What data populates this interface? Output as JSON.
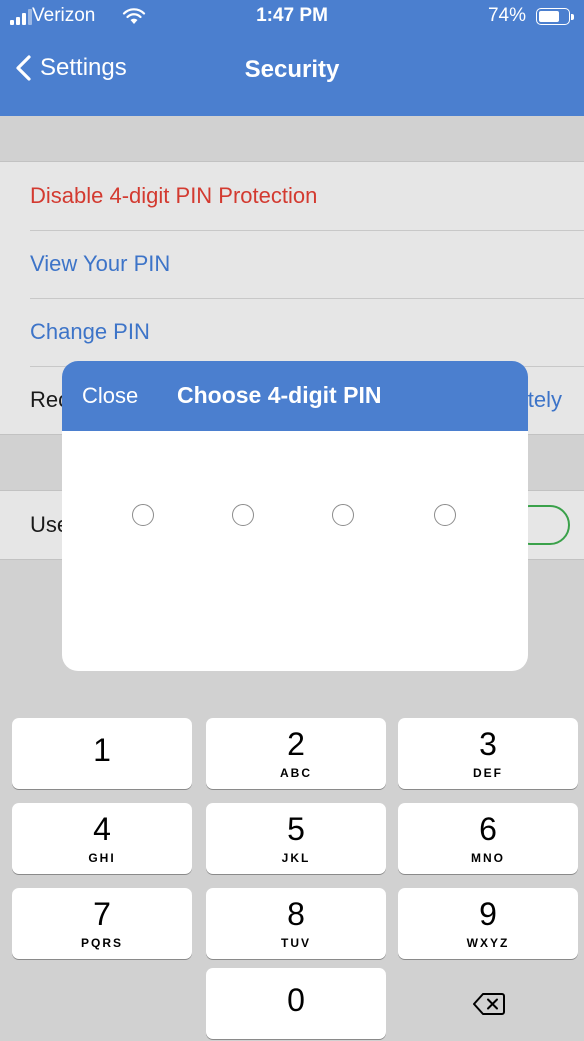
{
  "status": {
    "carrier": "Verizon",
    "time": "1:47 PM",
    "battery": "74%",
    "battery_level": 0.74
  },
  "nav": {
    "back_label": "Settings",
    "title": "Security"
  },
  "settings": {
    "disable_pin": "Disable 4-digit PIN Protection",
    "view_pin": "View Your PIN",
    "change_pin": "Change PIN",
    "require_pin_prefix": "Rec",
    "require_pin_value": "tely",
    "use_prefix": "Use",
    "use_toggle_on": true
  },
  "modal": {
    "close_label": "Close",
    "title": "Choose 4-digit PIN",
    "pin_slots": 4,
    "entered": 0
  },
  "keypad": {
    "keys": [
      {
        "num": "1",
        "letters": ""
      },
      {
        "num": "2",
        "letters": "ABC"
      },
      {
        "num": "3",
        "letters": "DEF"
      },
      {
        "num": "4",
        "letters": "GHI"
      },
      {
        "num": "5",
        "letters": "JKL"
      },
      {
        "num": "6",
        "letters": "MNO"
      },
      {
        "num": "7",
        "letters": "PQRS"
      },
      {
        "num": "8",
        "letters": "TUV"
      },
      {
        "num": "9",
        "letters": "WXYZ"
      },
      {
        "num": "0",
        "letters": ""
      }
    ],
    "delete_icon": "backspace-icon"
  },
  "colors": {
    "accent": "#4b7fcf",
    "destructive": "#d33a30",
    "link": "#3d74c8",
    "toggle": "#3aa14a"
  }
}
